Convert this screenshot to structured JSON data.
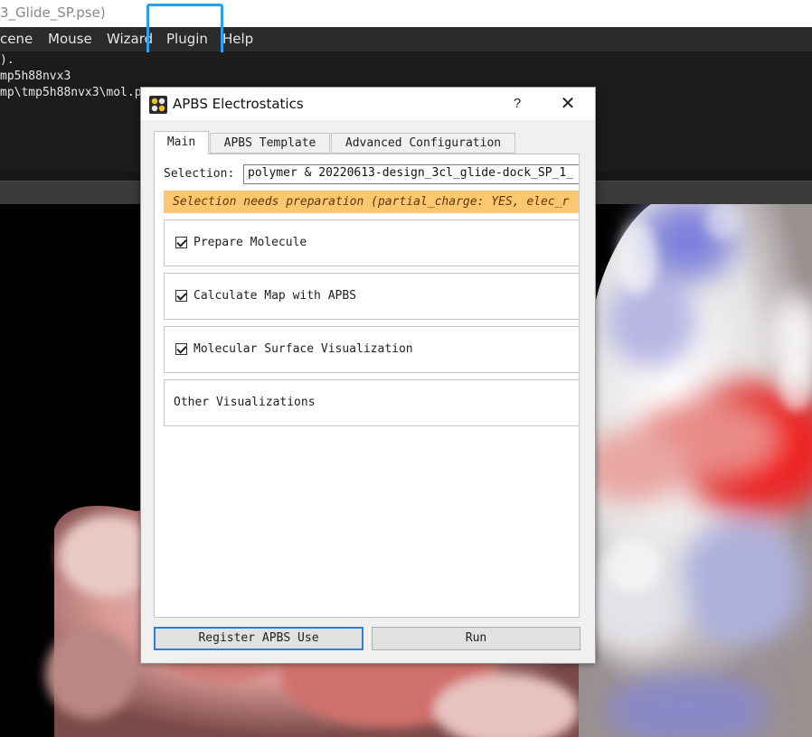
{
  "window": {
    "title": "3_Glide_SP.pse)"
  },
  "menubar": {
    "items": [
      "cene",
      "Mouse",
      "Wizard",
      "Plugin",
      "Help"
    ]
  },
  "console": {
    "lines": [
      ").",
      "mp5h88nvx3",
      "mp\\tmp5h88nvx3\\mol.p"
    ]
  },
  "dialog": {
    "title": "APBS Electrostatics",
    "help": "?",
    "close": "✕",
    "icons": {
      "app": "apbs-logo-icon"
    },
    "tabs": [
      "Main",
      "APBS Template",
      "Advanced Configuration"
    ],
    "selection_label": "Selection:",
    "selection_value": "polymer & 20220613-design_3cl_glide-dock_SP_1_",
    "warning": "Selection needs preparation (partial_charge: YES, elec_r",
    "sections": [
      {
        "label": "Prepare Molecule",
        "checked": true
      },
      {
        "label": "Calculate Map with APBS",
        "checked": true
      },
      {
        "label": "Molecular Surface Visualization",
        "checked": true
      },
      {
        "label": "Other Visualizations",
        "checked": false
      }
    ],
    "buttons": {
      "register": "Register APBS Use",
      "run": "Run"
    }
  },
  "colors": {
    "highlight": "#2d9df0",
    "warning_bg": "#fdc772",
    "menubar_bg": "#2b2b2b",
    "console_bg": "#1c1c1c"
  }
}
